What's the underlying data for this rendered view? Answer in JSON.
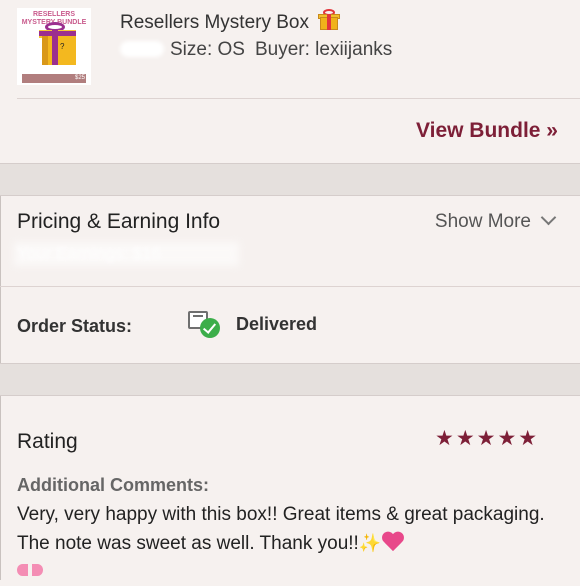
{
  "order": {
    "thumbnail_brand": "RESELLERS\nMYSTERY BUNDLE",
    "thumbnail_price": "$25",
    "title": "Resellers Mystery Box",
    "size_label": "Size: OS",
    "buyer_label": "Buyer: lexiijanks",
    "view_bundle": "View Bundle »"
  },
  "pricing": {
    "title": "Pricing & Earning Info",
    "show_more": "Show More",
    "earnings_blurred": "Your Earnings: $16"
  },
  "status": {
    "label": "Order Status:",
    "value": "Delivered"
  },
  "rating": {
    "label": "Rating",
    "stars": "★★★★★",
    "stars_value": 5,
    "stars_max": 5,
    "comments_label": "Additional Comments:",
    "comment": "Very, very happy with this box!! Great items & great packaging. The note was sweet as well. Thank you!!"
  },
  "colors": {
    "accent": "#7d1f37",
    "background": "#f6f1ef",
    "separator": "#e5e0dd",
    "check_green": "#3cae4a"
  },
  "icons": {
    "gift": "gift-icon",
    "delivered": "delivered-box-check-icon",
    "chevron": "chevron-down-icon",
    "sparkles": "sparkles-icon",
    "heart": "gift-heart-icon",
    "ribbon": "ribbon-bow-icon"
  }
}
